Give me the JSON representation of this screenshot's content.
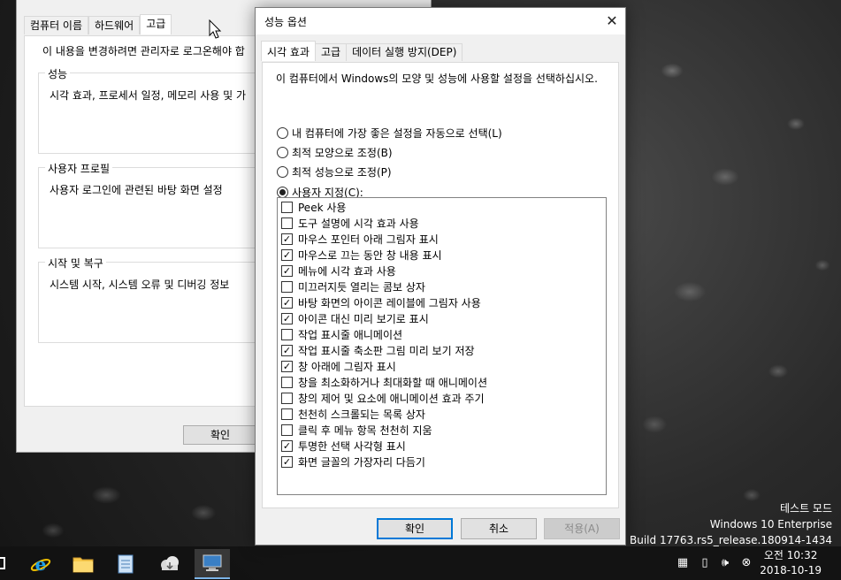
{
  "system_properties": {
    "tabs": [
      "컴퓨터 이름",
      "하드웨어",
      "고급"
    ],
    "active_tab": "고급",
    "admin_note": "이 내용을 변경하려면 관리자로 로그온해야 합",
    "groups": [
      {
        "label": "성능",
        "description": "시각 효과, 프로세서 일정, 메모리 사용 및 가"
      },
      {
        "label": "사용자 프로필",
        "description": "사용자 로그인에 관련된 바탕 화면 설정"
      },
      {
        "label": "시작 및 복구",
        "description": "시스템 시작, 시스템 오류 및 디버깅 정보"
      }
    ],
    "ok_label": "확인"
  },
  "performance_options": {
    "title": "성능 옵션",
    "close_glyph": "✕",
    "tabs": [
      "시각 효과",
      "고급",
      "데이터 실행 방지(DEP)"
    ],
    "active_tab": "시각 효과",
    "description": "이 컴퓨터에서 Windows의 모양 및 성능에 사용할 설정을 선택하십시오.",
    "radio_options": [
      {
        "label": "내 컴퓨터에 가장 좋은 설정을 자동으로 선택(L)",
        "checked": false
      },
      {
        "label": "최적 모양으로 조정(B)",
        "checked": false
      },
      {
        "label": "최적 성능으로 조정(P)",
        "checked": false
      },
      {
        "label": "사용자 지정(C):",
        "checked": true
      }
    ],
    "effects": [
      {
        "label": "Peek 사용",
        "checked": false
      },
      {
        "label": "도구 설명에 시각 효과 사용",
        "checked": false
      },
      {
        "label": "마우스 포인터 아래 그림자 표시",
        "checked": true
      },
      {
        "label": "마우스로 끄는 동안 창 내용 표시",
        "checked": true
      },
      {
        "label": "메뉴에 시각 효과 사용",
        "checked": true
      },
      {
        "label": "미끄러지듯 열리는 콤보 상자",
        "checked": false
      },
      {
        "label": "바탕 화면의 아이콘 레이블에 그림자 사용",
        "checked": true
      },
      {
        "label": "아이콘 대신 미리 보기로 표시",
        "checked": true
      },
      {
        "label": "작업 표시줄 애니메이션",
        "checked": false
      },
      {
        "label": "작업 표시줄 축소판 그림 미리 보기 저장",
        "checked": true
      },
      {
        "label": "창 아래에 그림자 표시",
        "checked": true
      },
      {
        "label": "창을 최소화하거나 최대화할 때 애니메이션",
        "checked": false
      },
      {
        "label": "창의 제어 및 요소에 애니메이션 효과 주기",
        "checked": false
      },
      {
        "label": "천천히 스크롤되는 목록 상자",
        "checked": false
      },
      {
        "label": "클릭 후 메뉴 항목 천천히 지움",
        "checked": false
      },
      {
        "label": "투명한 선택 사각형 표시",
        "checked": true
      },
      {
        "label": "화면 글꼴의 가장자리 다듬기",
        "checked": true
      }
    ],
    "buttons": {
      "ok": "확인",
      "cancel": "취소",
      "apply": "적용(A)"
    }
  },
  "watermark": {
    "line1": "테스트 모드",
    "line2": "Windows 10 Enterprise",
    "line3": "Build 17763.rs5_release.180914-1434"
  },
  "taskbar": {
    "apps": [
      "internet-explorer",
      "file-explorer",
      "notepad",
      "cloud",
      "system-properties"
    ],
    "active_app": "system-properties",
    "clock": {
      "time": "오전 10:32",
      "date": "2018-10-19"
    }
  },
  "colors": {
    "dialog_bg": "#f0f0f0",
    "panel_bg": "#ffffff",
    "accent": "#0078d7",
    "taskbar_bg": "#121212"
  }
}
